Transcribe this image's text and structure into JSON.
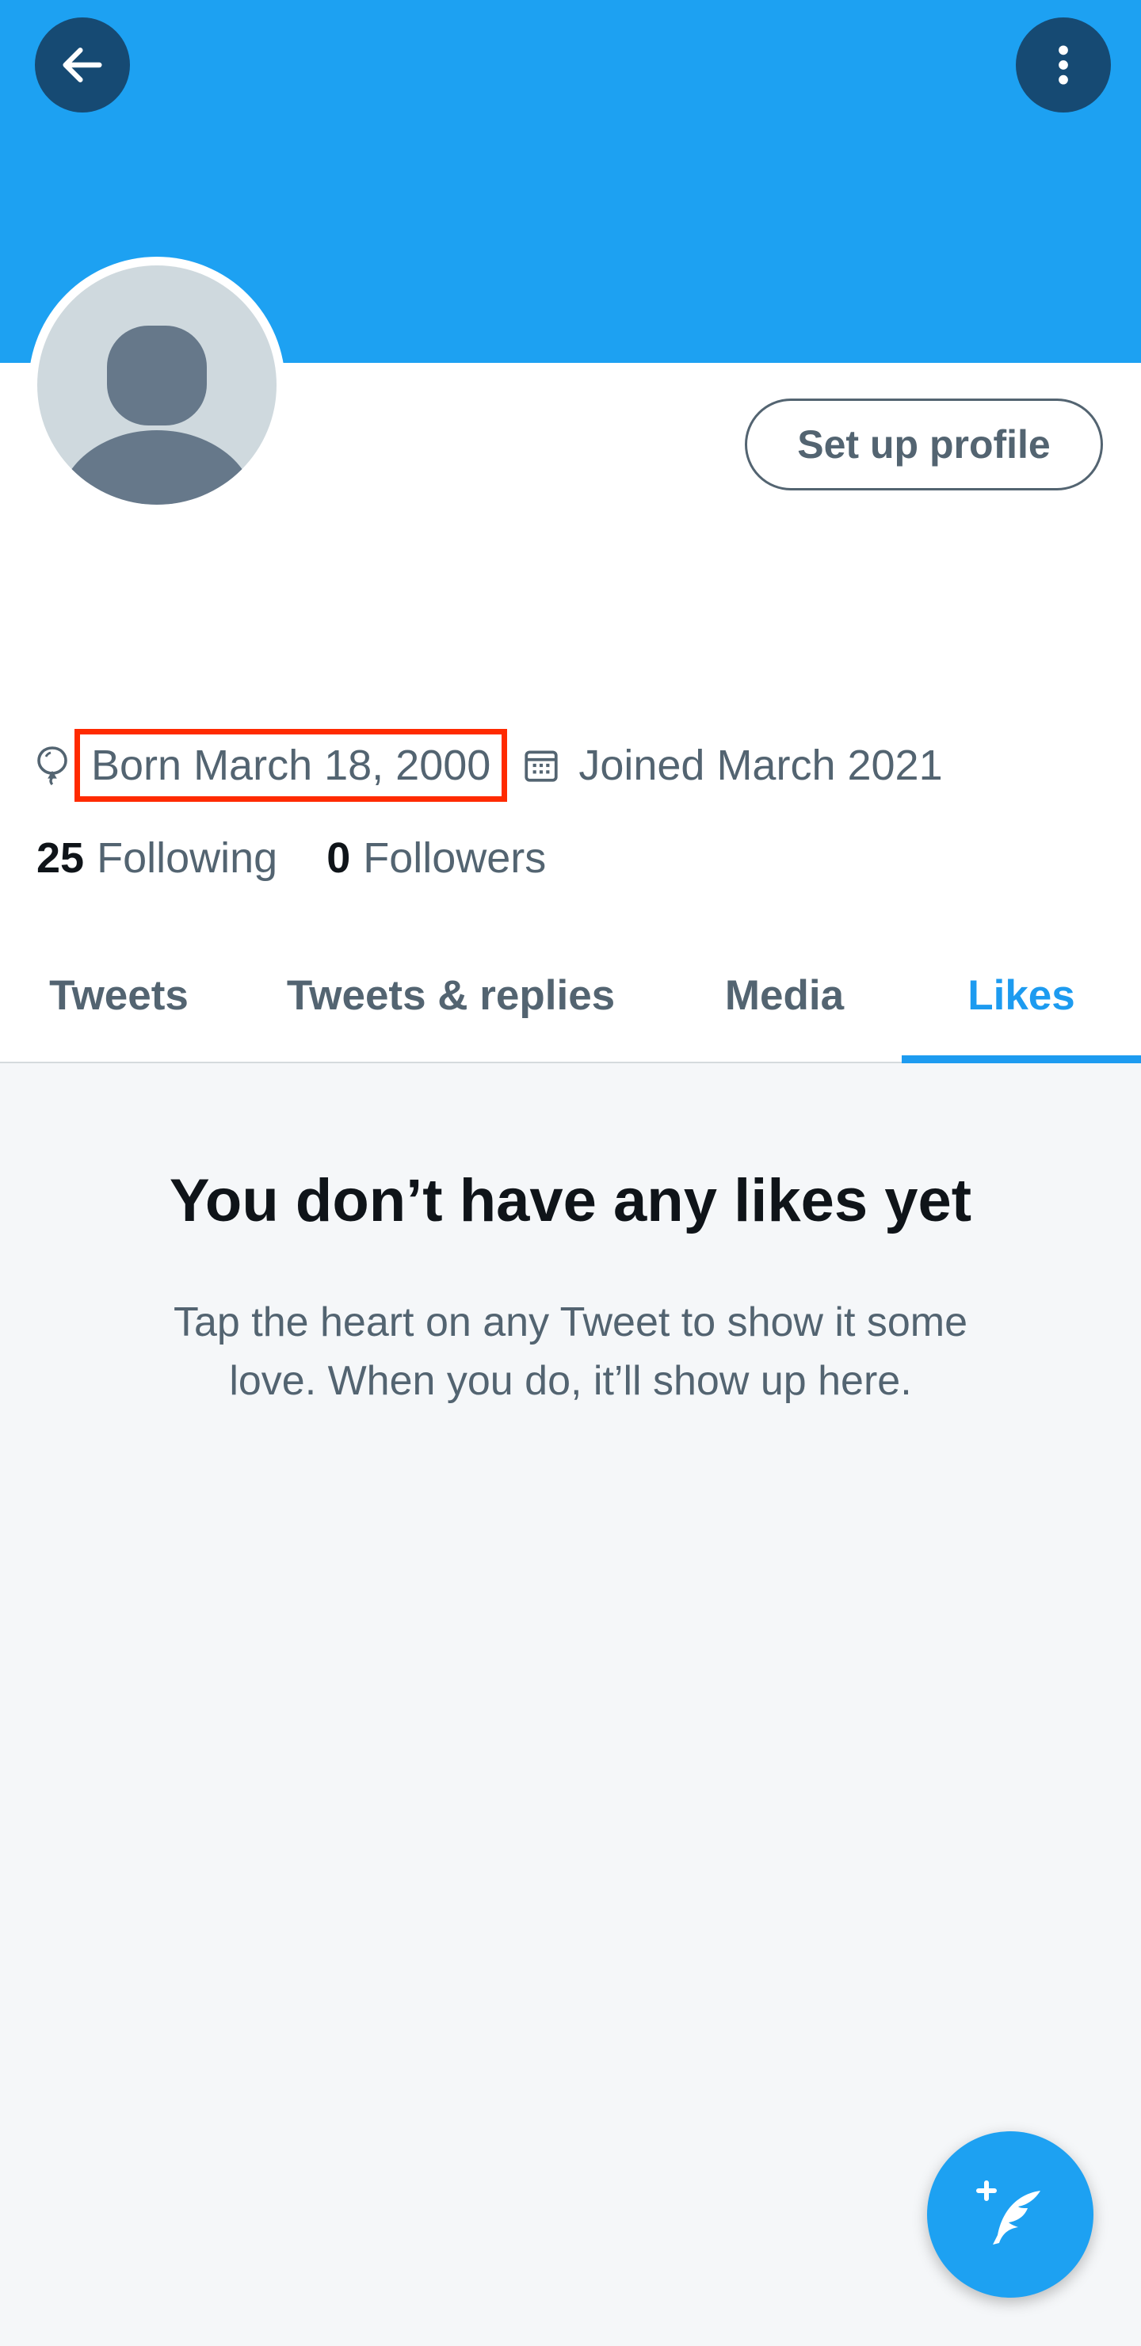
{
  "header": {
    "banner_color": "#1da1f2",
    "back_icon": "arrow-left-icon",
    "more_icon": "more-vertical-icon"
  },
  "profile": {
    "setup_button_label": "Set up profile",
    "born_label": "Born March 18, 2000",
    "joined_label": "Joined March 2021",
    "following_count": "25",
    "following_label": "Following",
    "followers_count": "0",
    "followers_label": "Followers"
  },
  "tabs": [
    {
      "label": "Tweets",
      "active": false
    },
    {
      "label": "Tweets & replies",
      "active": false
    },
    {
      "label": "Media",
      "active": false
    },
    {
      "label": "Likes",
      "active": true
    }
  ],
  "empty_state": {
    "title": "You don’t have any likes yet",
    "line1": "Tap the heart on any Tweet to show it some",
    "line2": "love. When you do, it’ll show up here."
  },
  "fab": {
    "icon": "compose-tweet-icon"
  },
  "colors": {
    "accent": "#1d9bf0",
    "highlight_box": "#ff2a00",
    "muted_text": "#536471"
  }
}
